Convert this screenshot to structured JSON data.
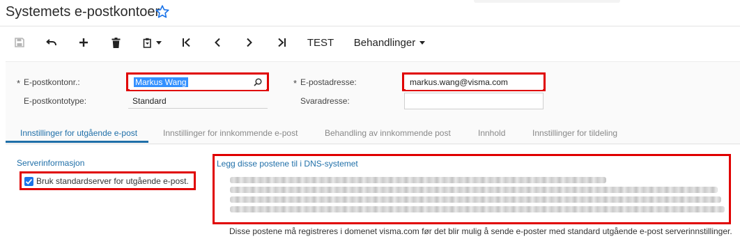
{
  "header": {
    "title": "Systemets e-postkontoer",
    "favorite_icon": "star-outline-icon"
  },
  "toolbar": {
    "test_label": "TEST",
    "actions_label": "Behandlinger",
    "icons": [
      "save-icon",
      "undo-icon",
      "add-icon",
      "delete-icon",
      "paste-icon",
      "first-record-icon",
      "previous-record-icon",
      "next-record-icon",
      "last-record-icon"
    ]
  },
  "form": {
    "account_id_label": "E-postkontonr.:",
    "account_id_value": "Markus Wang",
    "account_type_label": "E-postkontotype:",
    "account_type_value": "Standard",
    "email_label": "E-postadresse:",
    "email_value": "markus.wang@visma.com",
    "reply_label": "Svaradresse:",
    "reply_value": "",
    "required_mark": "*"
  },
  "tabs": [
    {
      "label": "Innstillinger for utgående e-post",
      "active": true
    },
    {
      "label": "Innstillinger for innkommende e-post",
      "active": false
    },
    {
      "label": "Behandling av innkommende post",
      "active": false
    },
    {
      "label": "Innhold",
      "active": false
    },
    {
      "label": "Innstillinger for tildeling",
      "active": false
    }
  ],
  "server_section": {
    "title": "Serverinformasjon",
    "checkbox_label": "Bruk standardserver for utgående e-post.",
    "checked": true
  },
  "dns_section": {
    "title": "Legg disse postene til i DNS-systemet",
    "note": "Disse postene må registreres i domenet visma.com før det blir mulig å sende e-poster med standard utgående e-post serverinnstillinger."
  },
  "colors": {
    "highlight_box": "#e00000",
    "accent": "#1f6fa8",
    "checkbox": "#1a73e8"
  }
}
